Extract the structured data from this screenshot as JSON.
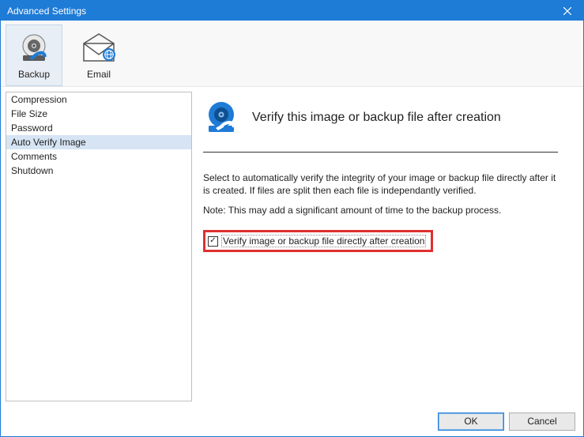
{
  "window": {
    "title": "Advanced Settings"
  },
  "ribbon": {
    "items": [
      {
        "label": "Backup"
      },
      {
        "label": "Email"
      }
    ],
    "selected_index": 0
  },
  "sidebar": {
    "items": [
      {
        "label": "Compression"
      },
      {
        "label": "File Size"
      },
      {
        "label": "Password"
      },
      {
        "label": "Auto Verify Image"
      },
      {
        "label": "Comments"
      },
      {
        "label": "Shutdown"
      }
    ],
    "selected_index": 3
  },
  "content": {
    "title": "Verify this image or backup file after creation",
    "description": "Select to automatically verify the integrity of your image or backup file directly after it is created. If files are split then each file is independantly verified.",
    "note": "Note: This may add a significant amount of time to the backup process.",
    "checkbox_label": "Verify image or backup file directly after creation",
    "checkbox_checked": true
  },
  "footer": {
    "ok": "OK",
    "cancel": "Cancel"
  }
}
